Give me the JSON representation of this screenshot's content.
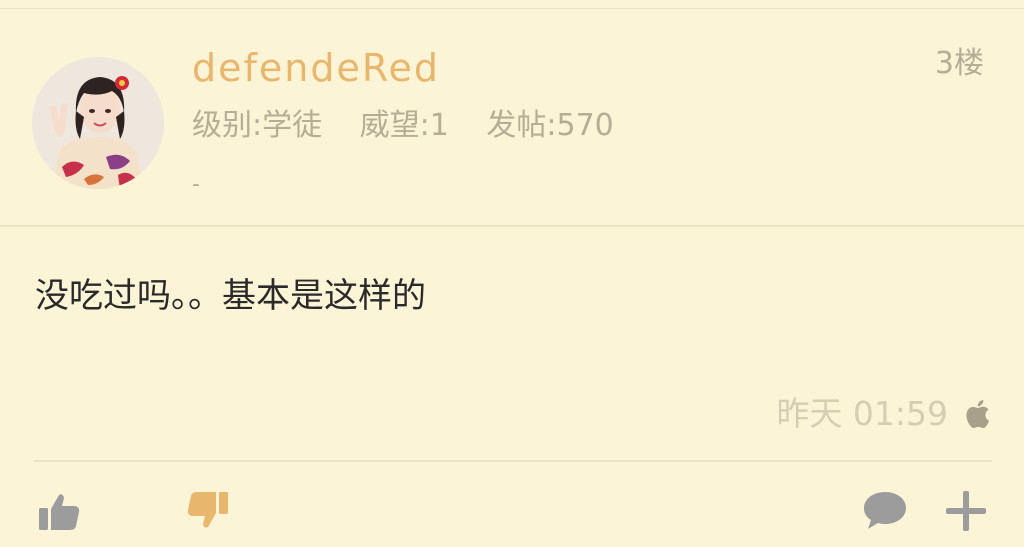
{
  "post": {
    "username": "defendeRed",
    "floor": "3楼",
    "stats": {
      "level": "级别:学徒",
      "prestige": "威望:1",
      "posts": "发帖:570"
    },
    "signature": "-",
    "content": "没吃过吗。。基本是这样的",
    "timestamp": "昨天 01:59",
    "device_icon": "apple-icon"
  },
  "actions": {
    "like_icon": "thumbs-up-icon",
    "dislike_icon": "thumbs-down-icon",
    "reply_icon": "comment-icon",
    "more_icon": "plus-icon"
  },
  "colors": {
    "background": "#fcf4d6",
    "username": "#e8b66c",
    "meta_text": "#b5ad96",
    "timestamp": "#d5cdb4",
    "dislike_active": "#e8b66c",
    "icon_gray": "#9c9c9c"
  }
}
